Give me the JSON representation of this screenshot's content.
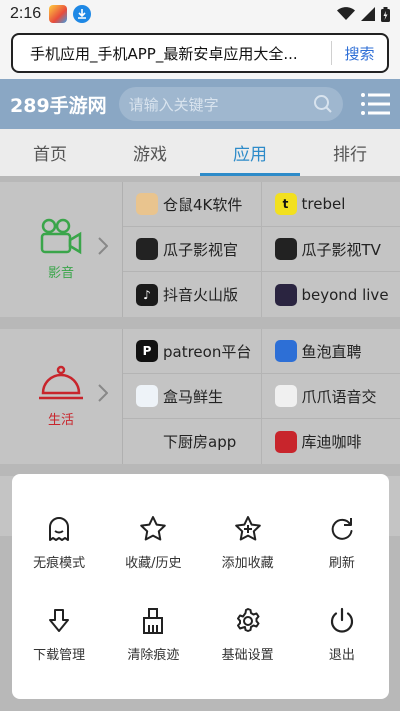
{
  "status_bar": {
    "time": "2:16"
  },
  "url_bar": {
    "text": "手机应用_手机APP_最新安卓应用大全...",
    "search_label": "搜索"
  },
  "site_header": {
    "logo": "289手游网",
    "search_placeholder": "请输入关键字"
  },
  "nav_tabs": [
    {
      "label": "首页"
    },
    {
      "label": "游戏"
    },
    {
      "label": "应用",
      "active": true
    },
    {
      "label": "排行"
    }
  ],
  "categories": [
    {
      "label": "影音",
      "color": "#3aa54a",
      "apps": [
        "仓鼠4K软件",
        "trebel",
        "瓜子影视官",
        "瓜子影视TV",
        "抖音火山版",
        "beyond live"
      ]
    },
    {
      "label": "生活",
      "color": "#c8252c",
      "apps": [
        "patreon平台",
        "鱼泡直聘",
        "盒马鲜生",
        "爪爪语音交",
        "下厨房app",
        "库迪咖啡"
      ]
    }
  ],
  "menu": [
    {
      "label": "无痕模式",
      "icon": "ghost-icon"
    },
    {
      "label": "收藏/历史",
      "icon": "star-icon"
    },
    {
      "label": "添加收藏",
      "icon": "star-plus-icon"
    },
    {
      "label": "刷新",
      "icon": "refresh-icon"
    },
    {
      "label": "下载管理",
      "icon": "download-arrow-icon"
    },
    {
      "label": "清除痕迹",
      "icon": "broom-icon"
    },
    {
      "label": "基础设置",
      "icon": "gear-icon"
    },
    {
      "label": "退出",
      "icon": "power-icon"
    }
  ]
}
